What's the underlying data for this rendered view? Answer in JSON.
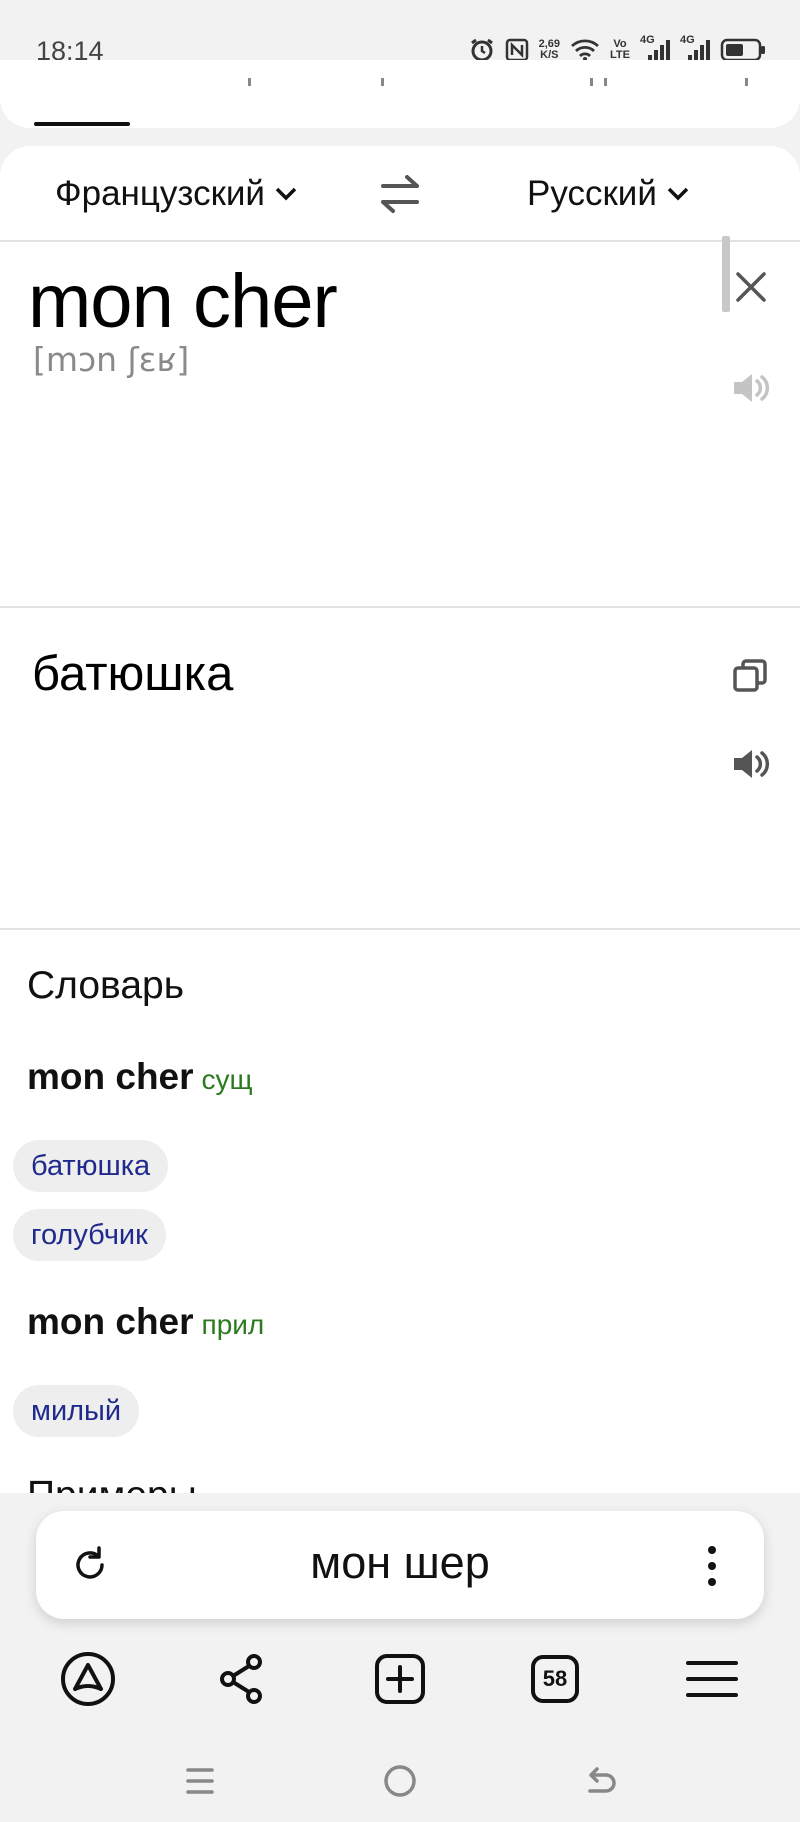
{
  "status_bar": {
    "time": "18:14",
    "net_speed_value": "2,69",
    "net_speed_unit": "K/S",
    "volte_top": "Vo",
    "volte_bottom": "LTE",
    "sim1_label": "4G",
    "sim2_label": "4G",
    "icons": [
      "alarm-icon",
      "nfc-icon",
      "wifi-icon",
      "signal-icon",
      "battery-icon"
    ]
  },
  "translator": {
    "source_language": "Французский",
    "target_language": "Русский",
    "source_text": "mon cher",
    "transcription": "[mɔn ʃɛʁ]",
    "translation": "батюшка"
  },
  "dictionary": {
    "title": "Словарь",
    "entries": [
      {
        "word": "mon cher",
        "pos": "сущ",
        "translations": [
          "батюшка",
          "голубчик"
        ]
      },
      {
        "word": "mon cher",
        "pos": "прил",
        "translations": [
          "милый"
        ]
      }
    ],
    "next_section_cut": "Примеры"
  },
  "browser": {
    "address_text": "мон шер",
    "tabs_count": "58"
  },
  "colors": {
    "pos_green": "#2c7a1f",
    "chip_text": "#1f2a8c",
    "chip_bg": "#eeeeee"
  }
}
